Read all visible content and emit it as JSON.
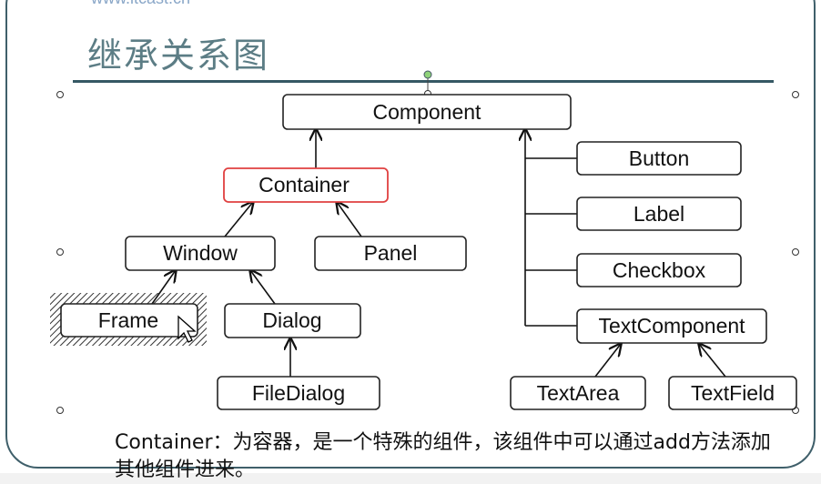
{
  "header": {
    "url": "www.itcast.cn"
  },
  "title": "继承关系图",
  "caption": "Container：为容器，是一个特殊的组件，该组件中可以通过add方法添加其他组件进来。",
  "colors": {
    "title": "#5c7d85",
    "rule": "#355864",
    "highlight_border": "#e04040",
    "box_border": "#222222"
  },
  "nodes": {
    "component": "Component",
    "container": "Container",
    "window": "Window",
    "panel": "Panel",
    "frame": "Frame",
    "dialog": "Dialog",
    "filedialog": "FileDialog",
    "button": "Button",
    "label": "Label",
    "checkbox": "Checkbox",
    "textcomponent": "TextComponent",
    "textarea": "TextArea",
    "textfield": "TextField"
  },
  "edges": [
    {
      "from": "container",
      "to": "component"
    },
    {
      "from": "window",
      "to": "container"
    },
    {
      "from": "panel",
      "to": "container"
    },
    {
      "from": "frame",
      "to": "window"
    },
    {
      "from": "dialog",
      "to": "window"
    },
    {
      "from": "filedialog",
      "to": "dialog"
    },
    {
      "from": "button",
      "to": "component"
    },
    {
      "from": "label",
      "to": "component"
    },
    {
      "from": "checkbox",
      "to": "component"
    },
    {
      "from": "textcomponent",
      "to": "component"
    },
    {
      "from": "textarea",
      "to": "textcomponent"
    },
    {
      "from": "textfield",
      "to": "textcomponent"
    }
  ]
}
